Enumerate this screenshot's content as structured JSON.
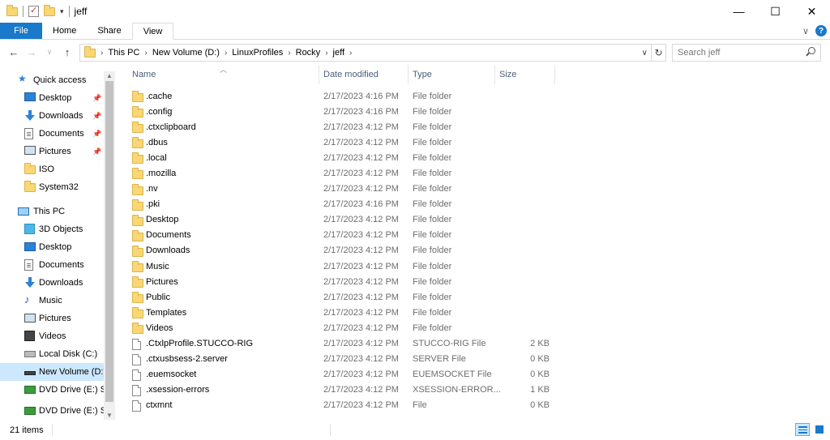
{
  "window": {
    "title": "jeff",
    "controls": {
      "minimize": "—",
      "maximize": "☐",
      "close": "✕"
    }
  },
  "ribbon": {
    "tabs": [
      {
        "label": "File"
      },
      {
        "label": "Home"
      },
      {
        "label": "Share"
      },
      {
        "label": "View"
      }
    ],
    "help": "?"
  },
  "address": {
    "crumbs": [
      "This PC",
      "New Volume (D:)",
      "LinuxProfiles",
      "Rocky",
      "jeff"
    ],
    "search_placeholder": "Search jeff"
  },
  "navpane": {
    "quick_access": "Quick access",
    "quick_items": [
      {
        "label": "Desktop",
        "icon": "desktop-icon",
        "pinned": true
      },
      {
        "label": "Downloads",
        "icon": "downloads-icon",
        "pinned": true
      },
      {
        "label": "Documents",
        "icon": "documents-icon",
        "pinned": true
      },
      {
        "label": "Pictures",
        "icon": "pictures-icon",
        "pinned": true
      },
      {
        "label": "ISO",
        "icon": "folder-icon",
        "pinned": false
      },
      {
        "label": "System32",
        "icon": "folder-icon",
        "pinned": false
      }
    ],
    "this_pc": "This PC",
    "pc_items": [
      {
        "label": "3D Objects",
        "icon": "3d-objects-icon"
      },
      {
        "label": "Desktop",
        "icon": "desktop-icon"
      },
      {
        "label": "Documents",
        "icon": "documents-icon"
      },
      {
        "label": "Downloads",
        "icon": "downloads-icon"
      },
      {
        "label": "Music",
        "icon": "music-icon"
      },
      {
        "label": "Pictures",
        "icon": "pictures-icon"
      },
      {
        "label": "Videos",
        "icon": "videos-icon"
      },
      {
        "label": "Local Disk (C:)",
        "icon": "local-disk-icon"
      },
      {
        "label": "New Volume (D:)",
        "icon": "drive-icon",
        "selected": true
      },
      {
        "label": "DVD Drive (E:) SS",
        "icon": "dvd-icon"
      },
      {
        "label": "DVD Drive (E:) SSS",
        "icon": "dvd-icon"
      }
    ]
  },
  "columns": {
    "name": "Name",
    "date": "Date modified",
    "type": "Type",
    "size": "Size"
  },
  "files": [
    {
      "name": ".cache",
      "date": "2/17/2023 4:16 PM",
      "type": "File folder",
      "size": "",
      "kind": "folder"
    },
    {
      "name": ".config",
      "date": "2/17/2023 4:16 PM",
      "type": "File folder",
      "size": "",
      "kind": "folder"
    },
    {
      "name": ".ctxclipboard",
      "date": "2/17/2023 4:12 PM",
      "type": "File folder",
      "size": "",
      "kind": "folder"
    },
    {
      "name": ".dbus",
      "date": "2/17/2023 4:12 PM",
      "type": "File folder",
      "size": "",
      "kind": "folder"
    },
    {
      "name": ".local",
      "date": "2/17/2023 4:12 PM",
      "type": "File folder",
      "size": "",
      "kind": "folder"
    },
    {
      "name": ".mozilla",
      "date": "2/17/2023 4:12 PM",
      "type": "File folder",
      "size": "",
      "kind": "folder"
    },
    {
      "name": ".nv",
      "date": "2/17/2023 4:12 PM",
      "type": "File folder",
      "size": "",
      "kind": "folder"
    },
    {
      "name": ".pki",
      "date": "2/17/2023 4:16 PM",
      "type": "File folder",
      "size": "",
      "kind": "folder"
    },
    {
      "name": "Desktop",
      "date": "2/17/2023 4:12 PM",
      "type": "File folder",
      "size": "",
      "kind": "folder"
    },
    {
      "name": "Documents",
      "date": "2/17/2023 4:12 PM",
      "type": "File folder",
      "size": "",
      "kind": "folder"
    },
    {
      "name": "Downloads",
      "date": "2/17/2023 4:12 PM",
      "type": "File folder",
      "size": "",
      "kind": "folder"
    },
    {
      "name": "Music",
      "date": "2/17/2023 4:12 PM",
      "type": "File folder",
      "size": "",
      "kind": "folder"
    },
    {
      "name": "Pictures",
      "date": "2/17/2023 4:12 PM",
      "type": "File folder",
      "size": "",
      "kind": "folder"
    },
    {
      "name": "Public",
      "date": "2/17/2023 4:12 PM",
      "type": "File folder",
      "size": "",
      "kind": "folder"
    },
    {
      "name": "Templates",
      "date": "2/17/2023 4:12 PM",
      "type": "File folder",
      "size": "",
      "kind": "folder"
    },
    {
      "name": "Videos",
      "date": "2/17/2023 4:12 PM",
      "type": "File folder",
      "size": "",
      "kind": "folder"
    },
    {
      "name": ".CtxlpProfile.STUCCO-RIG",
      "date": "2/17/2023 4:12 PM",
      "type": "STUCCO-RIG File",
      "size": "2 KB",
      "kind": "file"
    },
    {
      "name": ".ctxusbsess-2.server",
      "date": "2/17/2023 4:12 PM",
      "type": "SERVER File",
      "size": "0 KB",
      "kind": "file"
    },
    {
      "name": ".euemsocket",
      "date": "2/17/2023 4:12 PM",
      "type": "EUEMSOCKET File",
      "size": "0 KB",
      "kind": "file"
    },
    {
      "name": ".xsession-errors",
      "date": "2/17/2023 4:12 PM",
      "type": "XSESSION-ERROR...",
      "size": "1 KB",
      "kind": "file"
    },
    {
      "name": "ctxmnt",
      "date": "2/17/2023 4:12 PM",
      "type": "File",
      "size": "0 KB",
      "kind": "file"
    }
  ],
  "status": {
    "item_count": "21 items"
  }
}
